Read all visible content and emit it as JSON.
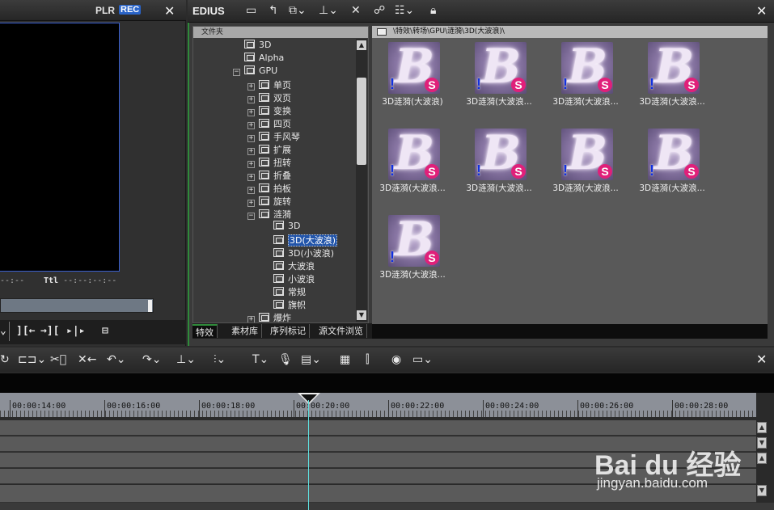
{
  "player": {
    "plr_label": "PLR",
    "rec_label": "REC",
    "close_glyph": "✕",
    "timecode": "--:--",
    "ttl_label": "Ttl",
    "ttl_value": "--:--:--:--",
    "controls": [
      "][←",
      "→][",
      "▸|▸",
      "⊟"
    ],
    "scrub_fraction": 0.97
  },
  "bin": {
    "logo": "EDIUS",
    "close_glyph": "✕",
    "toolbar_icons": [
      "folder-icon",
      "folder-up-icon",
      "add-clip-icon",
      "add-to-timeline-icon",
      "delete-icon",
      "properties-icon",
      "view-icon",
      "lock-icon"
    ],
    "tree_header": "文件夹",
    "tree": [
      {
        "label": "3D",
        "indent": 0,
        "expander": ""
      },
      {
        "label": "Alpha",
        "indent": 0,
        "expander": ""
      },
      {
        "label": "GPU",
        "indent": 0,
        "expander": "−",
        "open": true
      },
      {
        "label": "单页",
        "indent": 1,
        "expander": "+"
      },
      {
        "label": "双页",
        "indent": 1,
        "expander": "+"
      },
      {
        "label": "变换",
        "indent": 1,
        "expander": "+"
      },
      {
        "label": "四页",
        "indent": 1,
        "expander": "+"
      },
      {
        "label": "手风琴",
        "indent": 1,
        "expander": "+"
      },
      {
        "label": "扩展",
        "indent": 1,
        "expander": "+"
      },
      {
        "label": "扭转",
        "indent": 1,
        "expander": "+"
      },
      {
        "label": "折叠",
        "indent": 1,
        "expander": "+"
      },
      {
        "label": "拍板",
        "indent": 1,
        "expander": "+"
      },
      {
        "label": "旋转",
        "indent": 1,
        "expander": "+"
      },
      {
        "label": "涟漪",
        "indent": 1,
        "expander": "−",
        "open": true
      },
      {
        "label": "3D",
        "indent": 2,
        "expander": ""
      },
      {
        "label": "3D(大波浪)",
        "indent": 2,
        "expander": "",
        "selected": true
      },
      {
        "label": "3D(小波浪)",
        "indent": 2,
        "expander": ""
      },
      {
        "label": "大波浪",
        "indent": 2,
        "expander": ""
      },
      {
        "label": "小波浪",
        "indent": 2,
        "expander": ""
      },
      {
        "label": "常规",
        "indent": 2,
        "expander": ""
      },
      {
        "label": "旗帜",
        "indent": 2,
        "expander": ""
      },
      {
        "label": "爆炸",
        "indent": 1,
        "expander": "+"
      }
    ],
    "tabs": [
      "特效",
      "素材库",
      "序列标记",
      "源文件浏览"
    ],
    "active_tab": 0,
    "path": "\\特效\\转场\\GPU\\涟漪\\3D(大波浪)\\",
    "clips": [
      "3D涟漪(大波浪)",
      "3D涟漪(大波浪...",
      "3D涟漪(大波浪...",
      "3D涟漪(大波浪...",
      "3D涟漪(大波浪...",
      "3D涟漪(大波浪...",
      "3D涟漪(大波浪...",
      "3D涟漪(大波浪...",
      "3D涟漪(大波浪..."
    ],
    "thumb_letter": "B",
    "thumb_warn": "!",
    "thumb_badge": "S"
  },
  "timeline": {
    "close_glyph": "✕",
    "ruler": [
      "00:00:14:00",
      "00:00:16:00",
      "00:00:18:00",
      "00:00:20:00",
      "00:00:22:00",
      "00:00:24:00",
      "00:00:26:00",
      "00:00:28:00"
    ],
    "current_time": "00:00:20:00",
    "tool_icons": [
      "undo-icon",
      "redo-icon",
      "cut-icon",
      "delete-icon",
      "mark-in-icon",
      "mark-out-icon",
      "split-icon",
      "title-icon",
      "mic-icon",
      "render-icon",
      "layout-icon",
      "mixer-icon",
      "color-icon",
      "export-icon"
    ]
  },
  "watermark": {
    "logo": "Bai du 经验",
    "url": "jingyan.baidu.com"
  },
  "colors": {
    "accent_green": "#2f8a3a",
    "selection_blue": "#2255aa",
    "rec_blue": "#2a64c8",
    "badge_pink": "#e0207a",
    "cursor_cyan": "#5ee0e0"
  }
}
